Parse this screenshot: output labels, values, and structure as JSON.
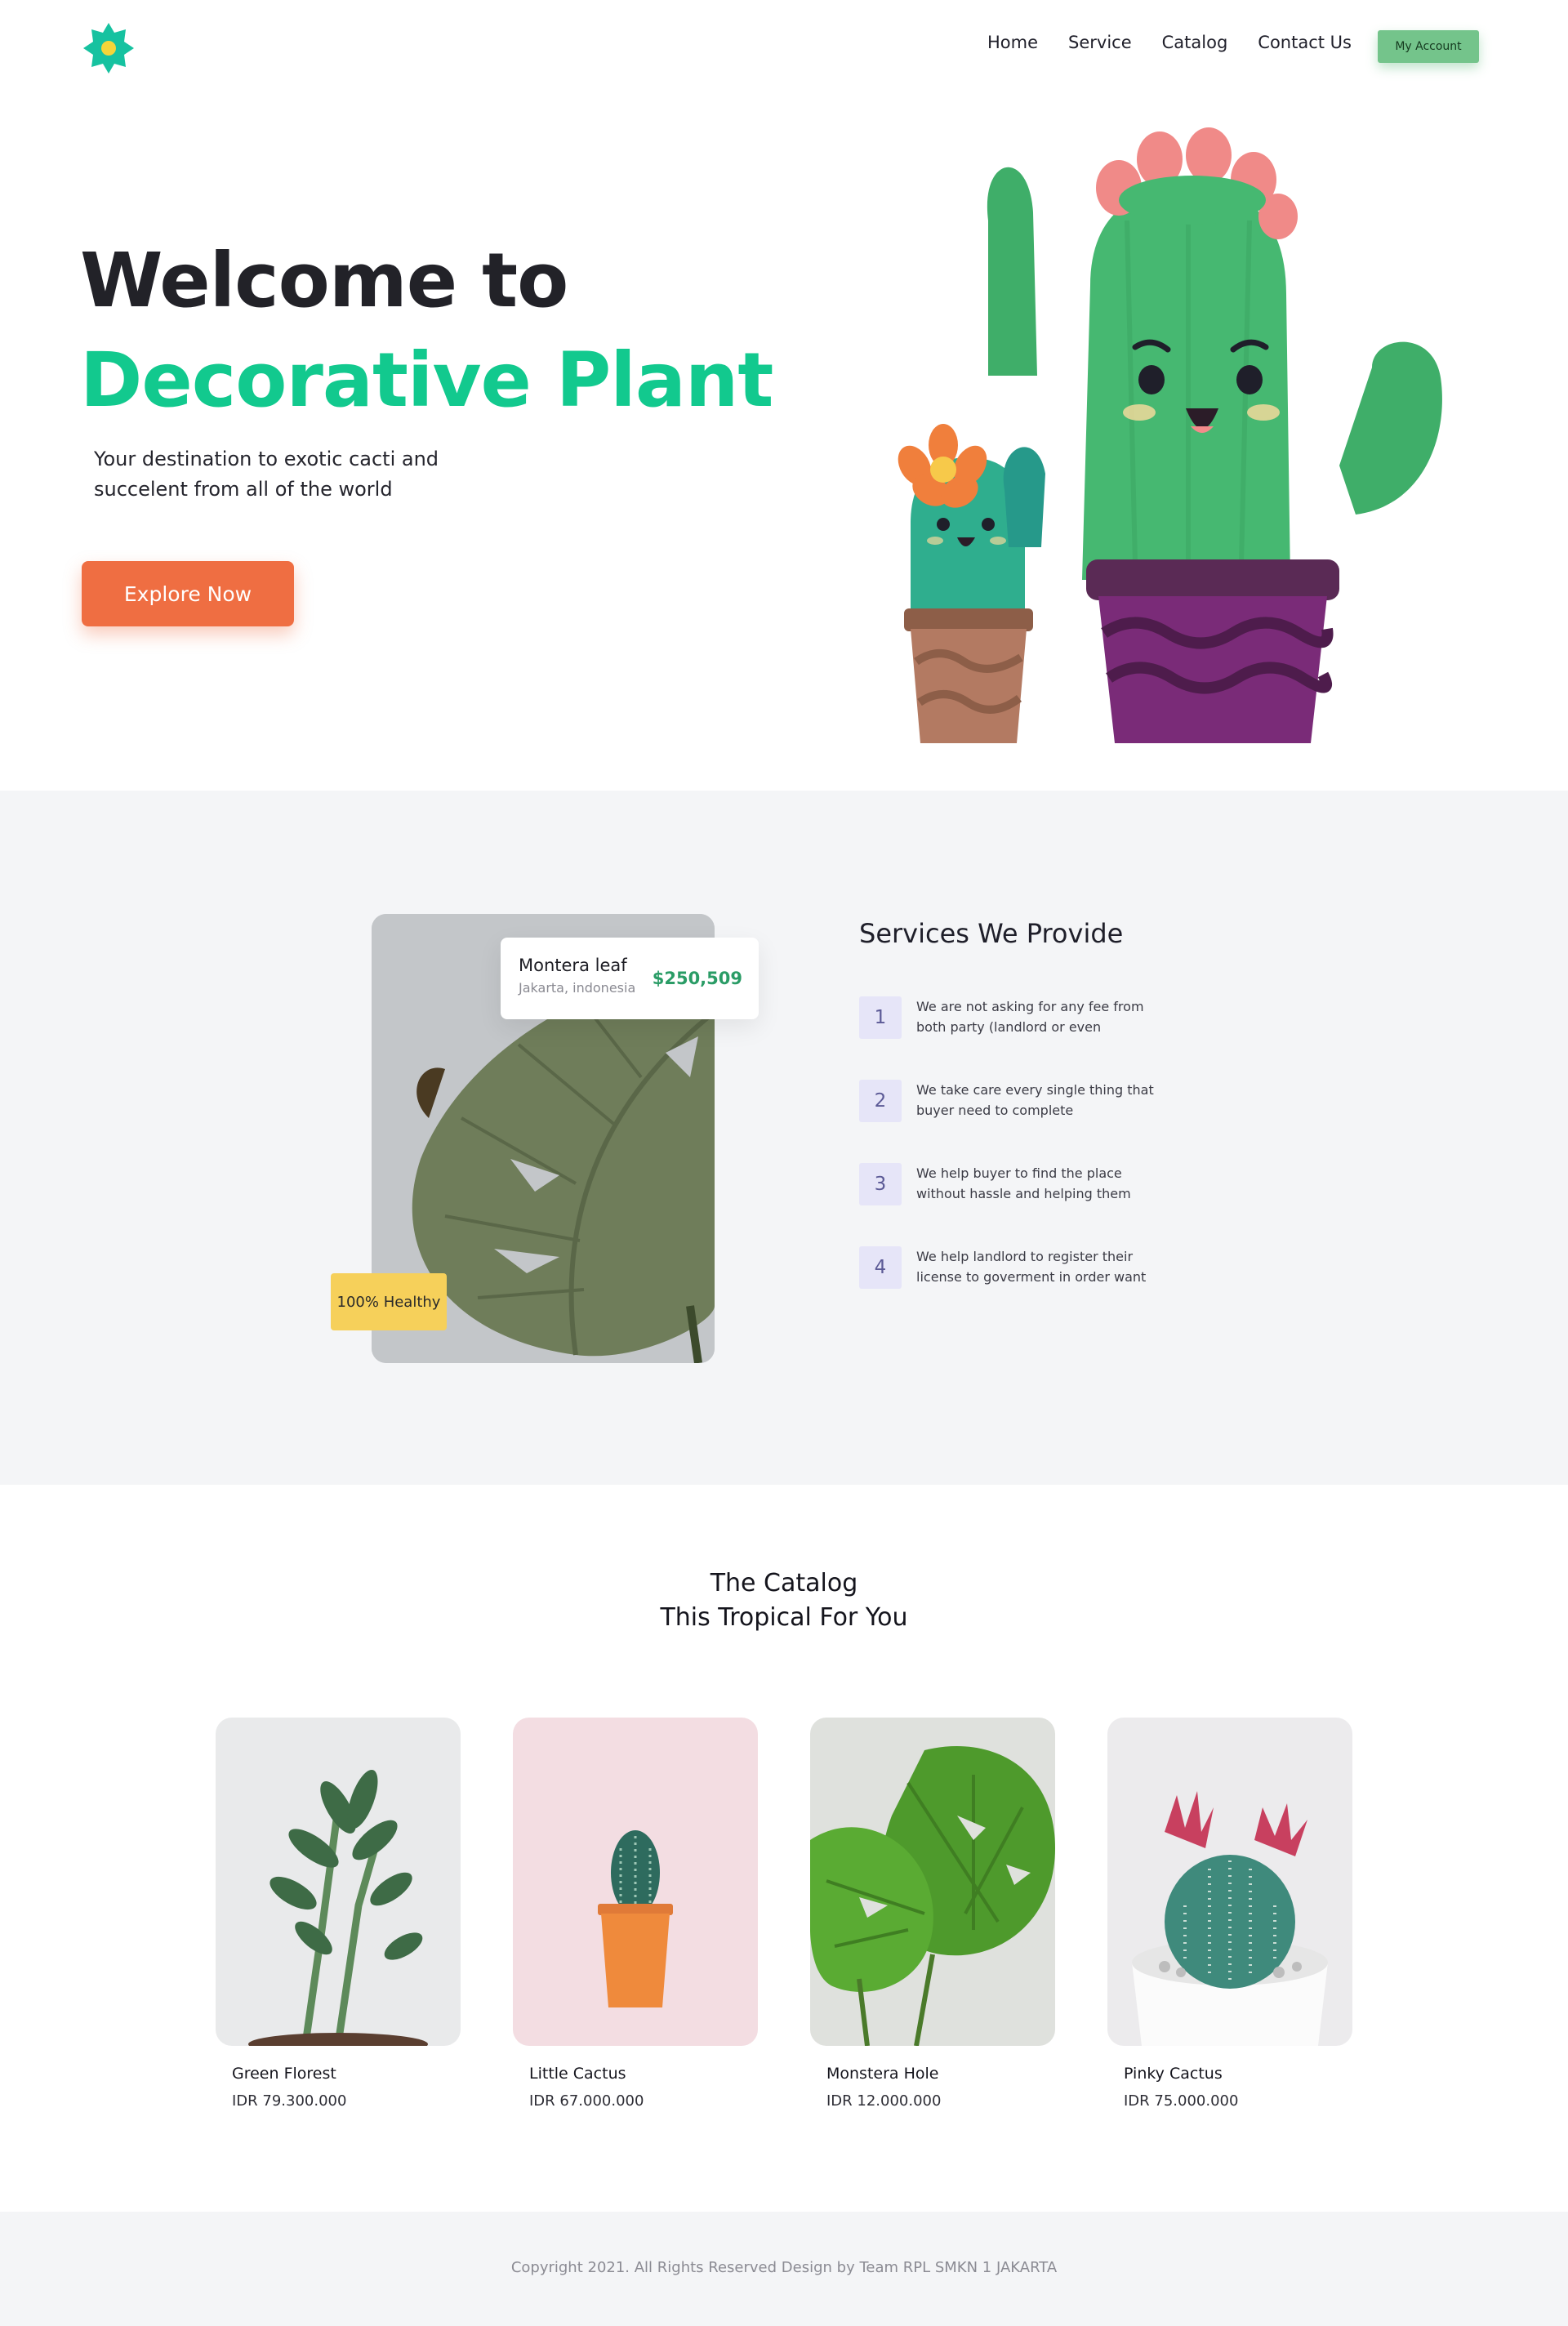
{
  "nav": {
    "links": [
      "Home",
      "Service",
      "Catalog",
      "Contact Us"
    ],
    "account_label": "My Account"
  },
  "hero": {
    "title_line1": "Welcome to",
    "title_line2": "Decorative Plant",
    "subtitle": "Your destination to exotic cacti and succelent from all of the world",
    "cta_label": "Explore Now"
  },
  "services": {
    "title": "Services We Provide",
    "featured": {
      "name": "Montera leaf",
      "location": "Jakarta, indonesia",
      "price": "$250,509",
      "badge": "100% Healthy"
    },
    "items": [
      {
        "num": "1",
        "text": "We are not asking for any fee from both party (landlord or even"
      },
      {
        "num": "2",
        "text": "We take care every single thing that buyer need to complete"
      },
      {
        "num": "3",
        "text": "We help buyer to find the place without hassle and helping them"
      },
      {
        "num": "4",
        "text": "We help landlord to register their license to goverment in order want"
      }
    ]
  },
  "catalog": {
    "title_line1": "The Catalog",
    "title_line2": "This Tropical For You",
    "products": [
      {
        "name": "Green Florest",
        "price": "IDR 79.300.000"
      },
      {
        "name": "Little Cactus",
        "price": "IDR 67.000.000"
      },
      {
        "name": "Monstera Hole",
        "price": "IDR 12.000.000"
      },
      {
        "name": "Pinky Cactus",
        "price": "IDR 75.000.000"
      }
    ]
  },
  "footer": {
    "copyright": "Copyright 2021. All Rights Reserved Design by Team RPL SMKN 1 JAKARTA"
  },
  "colors": {
    "brand_green": "#12c98e",
    "cta_orange": "#ef6e42",
    "account_green": "#74c48b",
    "badge_yellow": "#f6d05a",
    "section_gray": "#f4f5f7"
  }
}
